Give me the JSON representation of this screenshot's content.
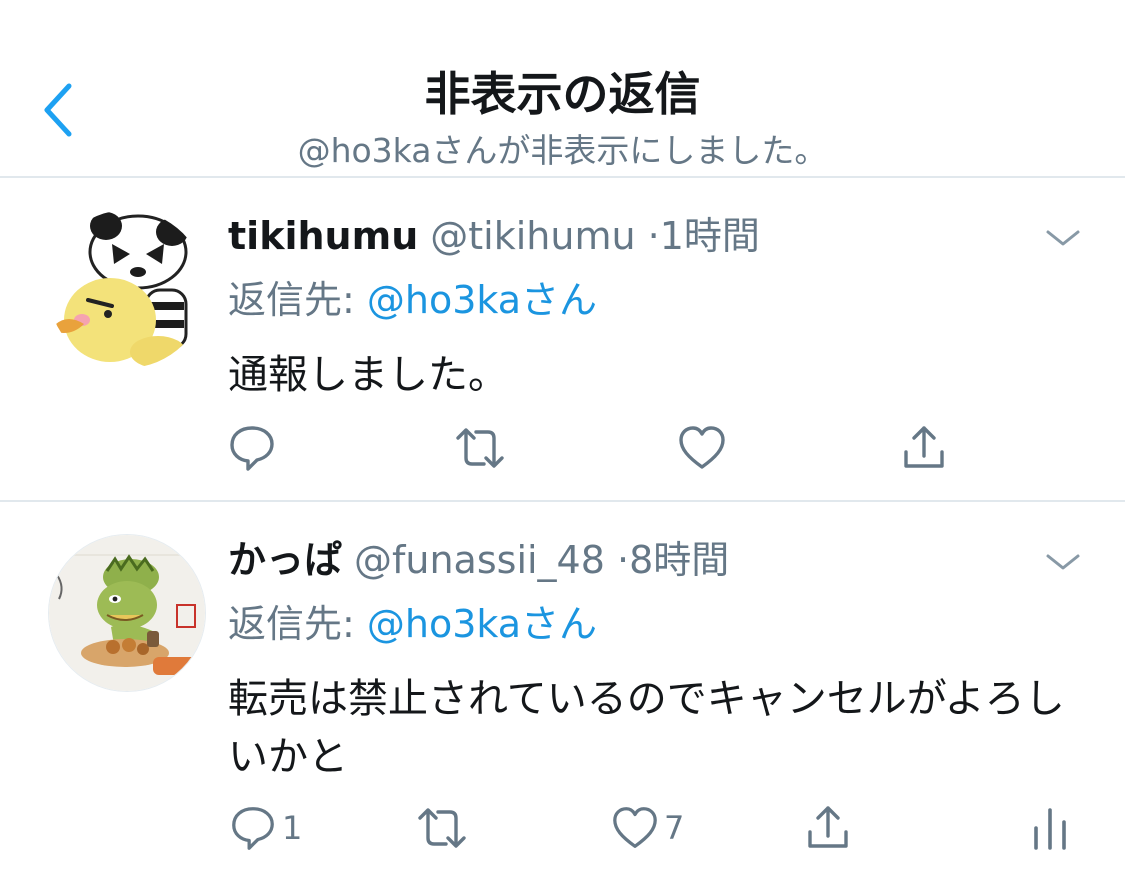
{
  "header": {
    "title": "非表示の返信",
    "subtitle": "@ho3kaさんが非表示にしました。"
  },
  "tweets": [
    {
      "display_name": "tikihumu",
      "handle": "@tikihumu",
      "separator": "·",
      "time": "1時間",
      "reply_label": "返信先:",
      "reply_mention": "@ho3kaさん",
      "text": "通報しました。",
      "reply_count": "",
      "like_count": ""
    },
    {
      "display_name": "かっぱ",
      "handle": "@funassii_48",
      "separator": "·",
      "time": "8時間",
      "reply_label": "返信先:",
      "reply_mention": "@ho3kaさん",
      "text": "転売は禁止されているのでキャンセルがよろしいかと",
      "reply_count": "1",
      "like_count": "7"
    }
  ],
  "colors": {
    "accent": "#1da1f2",
    "link": "#1b95e0",
    "secondary_text": "#657786",
    "icon": "#657786",
    "divider": "#e1e8ed"
  },
  "icons": {
    "back": "chevron-left-icon",
    "caret": "chevron-down-icon",
    "reply": "reply-icon",
    "retweet": "retweet-icon",
    "like": "heart-icon",
    "share": "share-icon",
    "analytics": "analytics-icon"
  }
}
